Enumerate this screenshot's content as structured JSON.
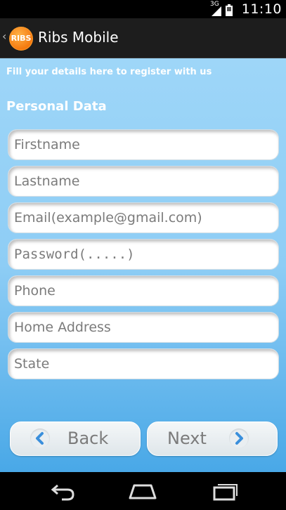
{
  "status": {
    "network": "3G",
    "time": "11:10"
  },
  "actionbar": {
    "logo_text": "RIBS",
    "title": "Ribs Mobile"
  },
  "form": {
    "intro": "Fill your details here to register with us",
    "section_title": "Personal Data",
    "fields": {
      "firstname": "Firstname",
      "lastname": "Lastname",
      "email": "Email(example@gmail.com)",
      "password": "Password(.....)",
      "phone": "Phone",
      "address": "Home Address",
      "state": "State"
    }
  },
  "buttons": {
    "back": "Back",
    "next": "Next"
  },
  "navigation": {
    "icons": [
      "back-icon",
      "home-icon",
      "recent-apps-icon"
    ]
  }
}
